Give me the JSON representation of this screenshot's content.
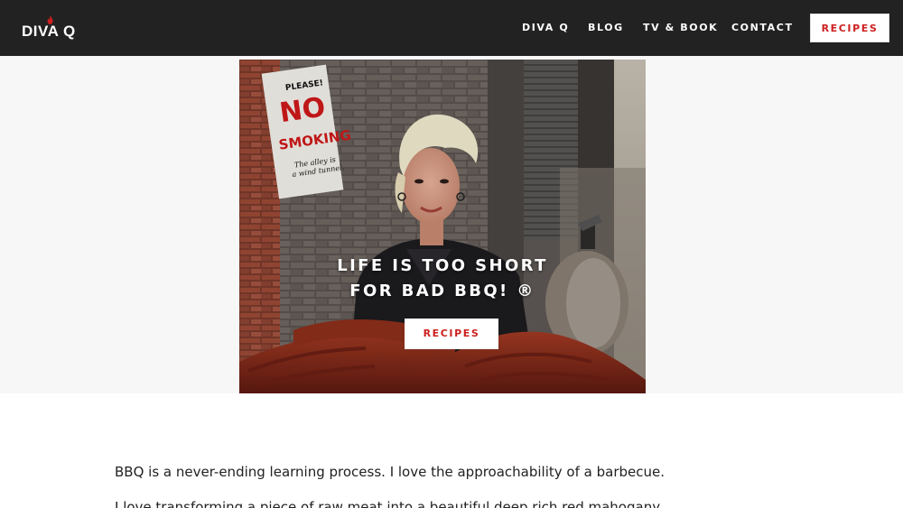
{
  "brand": {
    "logo_text": "DIVA Q"
  },
  "nav": {
    "items": [
      {
        "label": "DIVA Q"
      },
      {
        "label": "BLOG"
      },
      {
        "label": "TV & BOOK"
      },
      {
        "label": "CONTACT"
      }
    ],
    "cta_label": "RECIPES"
  },
  "hero": {
    "tagline_line1": "LIFE IS TOO SHORT",
    "tagline_line2": "FOR BAD BBQ! ®",
    "button_label": "RECIPES",
    "sign": {
      "line1": "PLEASE!",
      "line2": "NO",
      "line3": "SMOKING",
      "line4": "The alley is",
      "line5": "a wind tunnel."
    }
  },
  "content": {
    "paragraph1": "BBQ is a never-ending learning process. I love the approachability of a barbecue.",
    "paragraph2": "I love transforming a piece of raw meat into a beautiful deep rich red mahogany"
  },
  "colors": {
    "header_bg": "#222222",
    "accent_red": "#cc1f1f",
    "hero_bg": "#f7f7f7"
  }
}
